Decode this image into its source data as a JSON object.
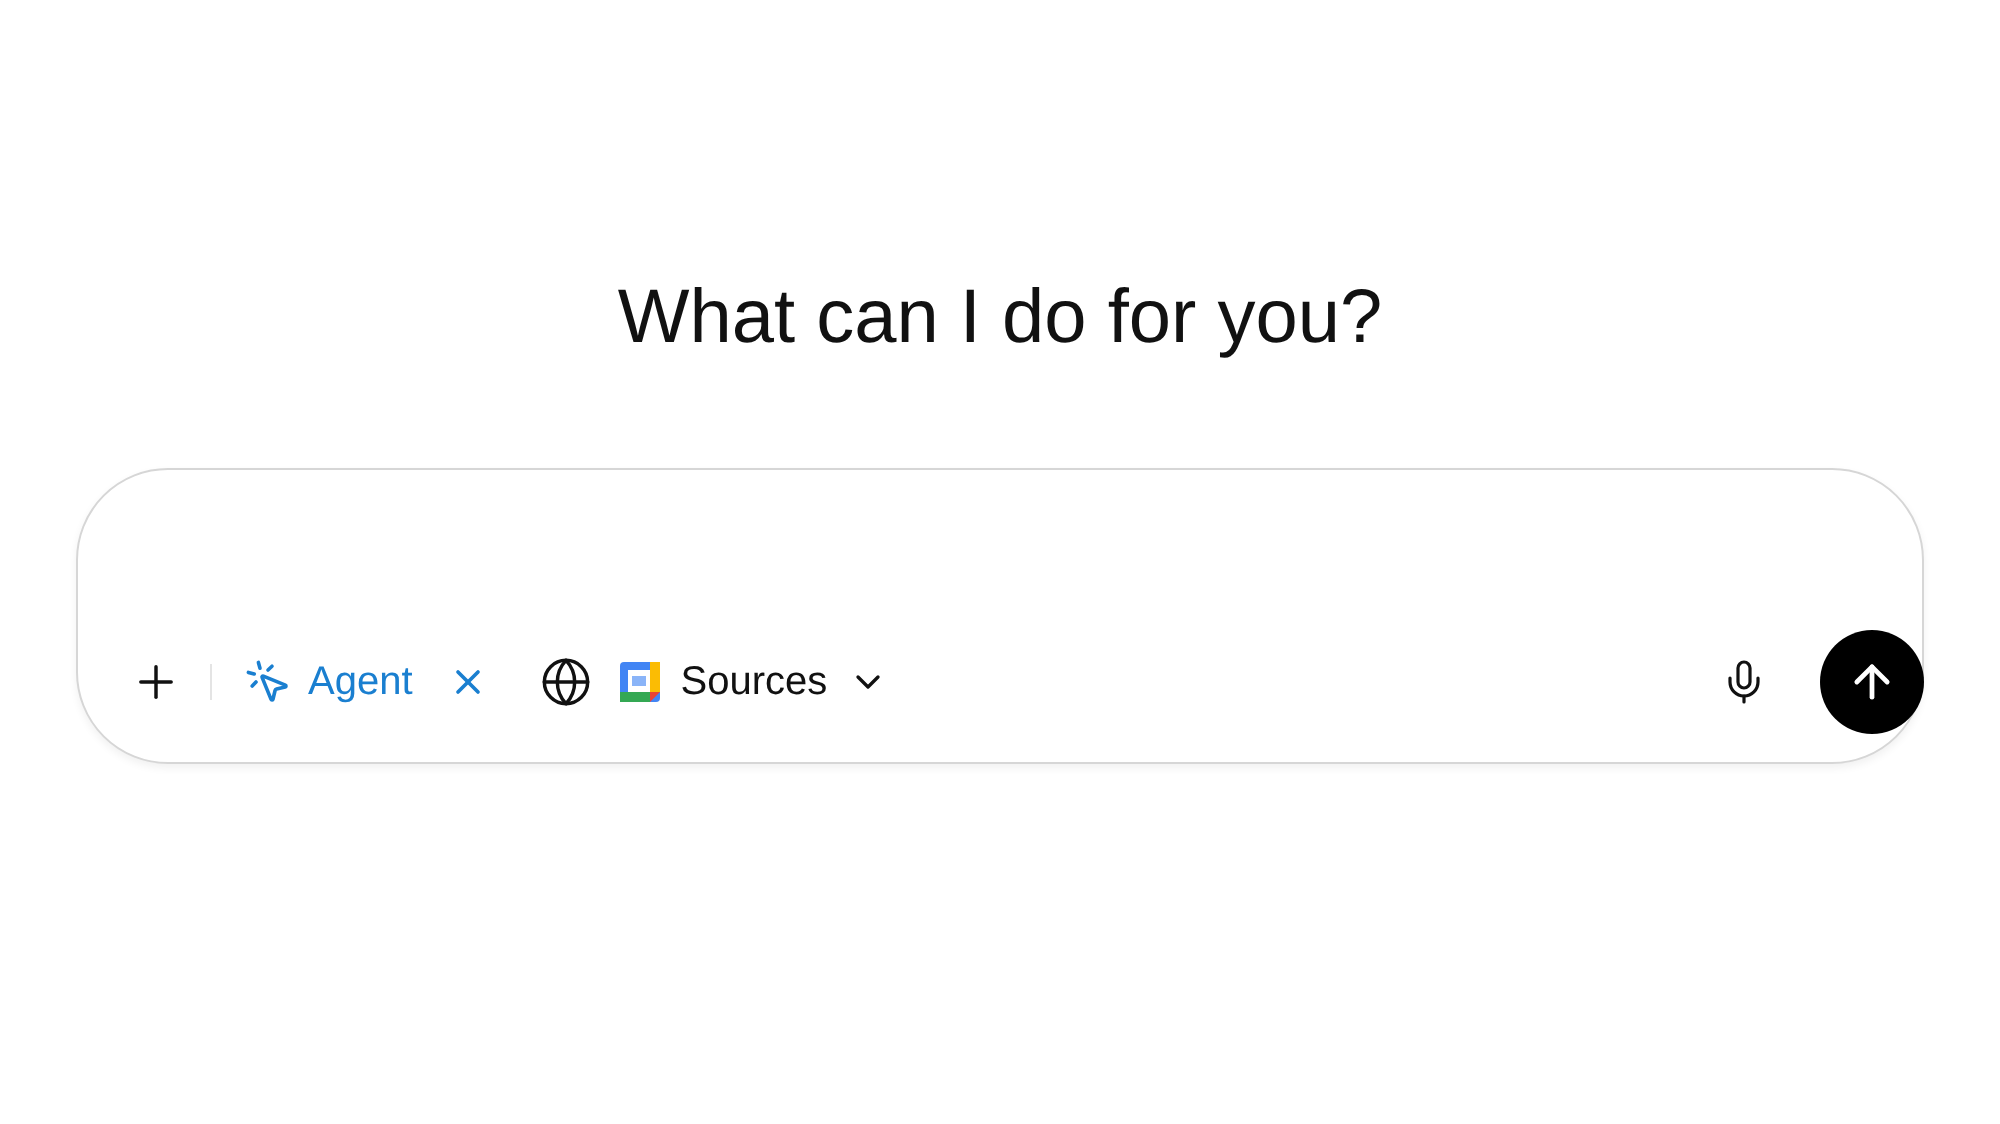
{
  "heading": "What can I do for you?",
  "composer": {
    "agent_chip": {
      "label": "Agent"
    },
    "sources": {
      "label": "Sources"
    }
  }
}
